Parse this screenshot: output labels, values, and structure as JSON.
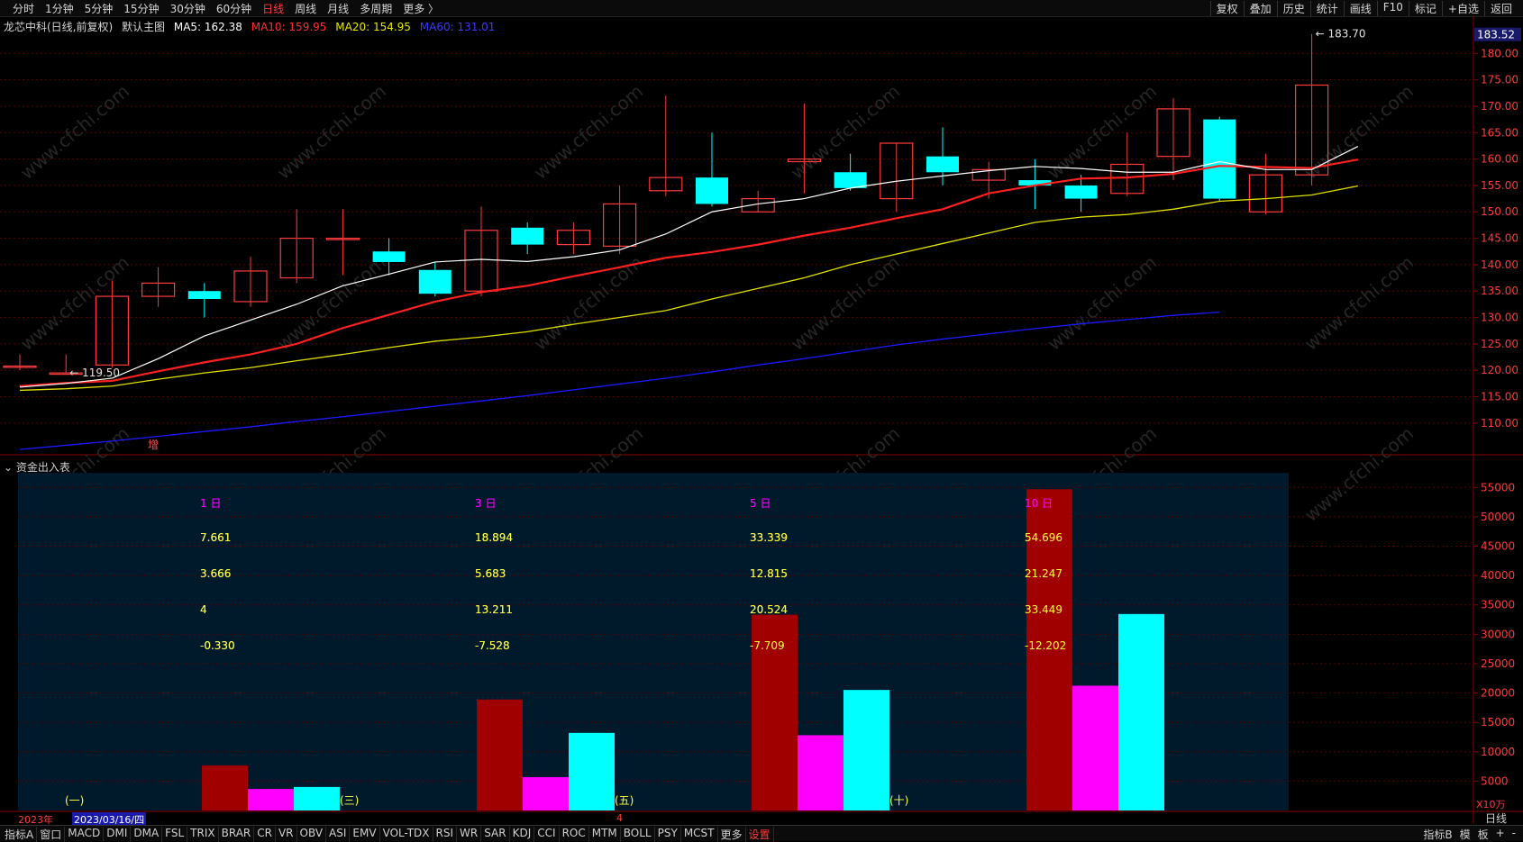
{
  "topbar": {
    "left_items": [
      "分时",
      "1分钟",
      "5分钟",
      "15分钟",
      "30分钟",
      "60分钟",
      "日线",
      "周线",
      "月线",
      "多周期",
      "更多 〉"
    ],
    "active_index": 6,
    "right_items": [
      "复权",
      "叠加",
      "历史",
      "统计",
      "画线",
      "F10",
      "标记",
      "+自选",
      "返回"
    ]
  },
  "info": {
    "title": "龙芯中科(日线,前复权)",
    "main_chart": "默认主图",
    "ma5": "MA5: 162.38",
    "ma10": "MA10: 159.95",
    "ma20": "MA20: 154.95",
    "ma60": "MA60: 131.01"
  },
  "colors": {
    "up": "#ff3b3b",
    "down": "#00ffff",
    "ma5": "#ffffff",
    "ma10": "#ff2020",
    "ma20": "#e0e000",
    "ma60": "#1a1aff",
    "grid": "#5a0000",
    "panel_bg": "#001a2b"
  },
  "price_axis": {
    "current_label": "183.52",
    "ticks": [
      "180.00",
      "175.00",
      "170.00",
      "165.00",
      "160.00",
      "155.00",
      "150.00",
      "145.00",
      "140.00",
      "135.00",
      "130.00",
      "125.00",
      "120.00",
      "115.00",
      "110.00"
    ]
  },
  "chart_data": {
    "type": "candlestick",
    "ylim": [
      104,
      185
    ],
    "candles": [
      [
        120.8,
        120.8,
        123,
        120
      ],
      [
        119.5,
        119.5,
        123,
        119.5
      ],
      [
        121,
        134,
        137,
        120.5
      ],
      [
        134,
        136.5,
        139.5,
        132
      ],
      [
        135,
        133.5,
        136.5,
        130
      ],
      [
        133,
        138.8,
        141.5,
        132
      ],
      [
        137.5,
        145,
        150.5,
        136.5
      ],
      [
        144.8,
        145,
        150.5,
        138
      ],
      [
        142.5,
        140.5,
        145,
        138
      ],
      [
        139,
        134.5,
        140.5,
        134
      ],
      [
        135,
        146.5,
        151,
        134
      ],
      [
        147,
        143.8,
        148,
        142
      ],
      [
        143.8,
        146.5,
        148,
        142
      ],
      [
        143.5,
        151.5,
        155,
        142
      ],
      [
        154,
        156.5,
        172,
        153
      ],
      [
        156.5,
        151.5,
        165,
        151
      ],
      [
        150,
        152.5,
        154,
        150
      ],
      [
        159.5,
        160,
        170.5,
        153.5
      ],
      [
        157.5,
        154.5,
        161,
        154
      ],
      [
        152.5,
        163,
        163,
        150
      ],
      [
        160.5,
        157.5,
        166,
        155
      ],
      [
        156,
        158,
        159.5,
        152.5
      ],
      [
        156,
        155,
        160,
        150.5
      ],
      [
        155,
        152.5,
        157,
        150
      ],
      [
        153.5,
        159,
        165,
        153
      ],
      [
        160.5,
        169.5,
        171.5,
        156
      ],
      [
        167.5,
        152.5,
        168,
        152
      ],
      [
        150,
        157,
        161,
        149.5
      ],
      [
        157,
        174,
        183.7,
        155
      ]
    ],
    "ma5": [
      116.8,
      117.5,
      118.5,
      122.2,
      126.5,
      129.5,
      132.5,
      136,
      138.2,
      140.5,
      141,
      140.6,
      141.5,
      142.8,
      145.8,
      150,
      151.5,
      152.5,
      154.5,
      155.8,
      156.8,
      157.8,
      158.6,
      158.2,
      157.5,
      157.5,
      159.5,
      158,
      158,
      162.4
    ],
    "ma10": [
      117,
      117.6,
      118,
      119.8,
      121.5,
      123,
      125,
      128,
      130.5,
      133,
      134.8,
      136,
      137.8,
      139.5,
      141.3,
      142.4,
      143.8,
      145.5,
      147,
      148.8,
      150.5,
      153.5,
      155,
      156.3,
      156.5,
      157.2,
      158.7,
      158.5,
      158.3,
      159.9
    ],
    "ma20": [
      116.2,
      116.5,
      117,
      118.3,
      119.5,
      120.5,
      121.8,
      123,
      124.3,
      125.5,
      126.3,
      127.3,
      128.7,
      130,
      131.3,
      133.5,
      135.5,
      137.5,
      140,
      142,
      144,
      146,
      148,
      149,
      149.5,
      150.5,
      152,
      152.5,
      153.2,
      154.9
    ],
    "ma60": [
      105,
      105.8,
      106.6,
      107.5,
      108.4,
      109.3,
      110.3,
      111.2,
      112.2,
      113.2,
      114.2,
      115.2,
      116.3,
      117.4,
      118.5,
      119.7,
      121,
      122.2,
      123.5,
      124.8,
      125.9,
      126.9,
      127.9,
      128.8,
      129.6,
      130.4,
      131.01
    ],
    "labels": {
      "high": "183.70",
      "low": "119.50"
    }
  },
  "fund_panel": {
    "title": "资金出入表",
    "groups": [
      {
        "header": "1 日",
        "values": [
          "7.661",
          "3.666",
          "4",
          "-0.330"
        ],
        "bars": [
          7661,
          3666,
          4000
        ],
        "footer": "(一)"
      },
      {
        "header": "3 日",
        "values": [
          "18.894",
          "5.683",
          "13.211",
          "-7.528"
        ],
        "bars": [
          18894,
          5683,
          13211
        ],
        "footer": "(三)"
      },
      {
        "header": "5 日",
        "values": [
          "33.339",
          "12.815",
          "20.524",
          "-7.709"
        ],
        "bars": [
          33339,
          12815,
          20524
        ],
        "footer": "(五)"
      },
      {
        "header": "10 日",
        "values": [
          "54.696",
          "21.247",
          "33.449",
          "-12.202"
        ],
        "bars": [
          54696,
          21247,
          33449
        ],
        "footer": "(十)"
      }
    ],
    "axis_ticks": [
      "55000",
      "50000",
      "45000",
      "40000",
      "35000",
      "30000",
      "25000",
      "20000",
      "15000",
      "10000",
      "5000"
    ],
    "unit": "X10万"
  },
  "datebar": {
    "year": "2023年",
    "date": "2023/03/16/四",
    "marker": "4"
  },
  "bottombar": {
    "items": [
      "指标A",
      "窗口",
      "MACD",
      "DMI",
      "DMA",
      "FSL",
      "TRIX",
      "BRAR",
      "CR",
      "VR",
      "OBV",
      "ASI",
      "EMV",
      "VOL-TDX",
      "RSI",
      "WR",
      "SAR",
      "KDJ",
      "CCI",
      "ROC",
      "MTM",
      "BOLL",
      "PSY",
      "MCST",
      "更多",
      "设置"
    ],
    "active_index": 25,
    "right_items": [
      "指标B",
      "模",
      "板",
      "+",
      "-"
    ]
  },
  "marker_text": "增",
  "period_label": "日线",
  "watermark": "www.cfchi.com"
}
